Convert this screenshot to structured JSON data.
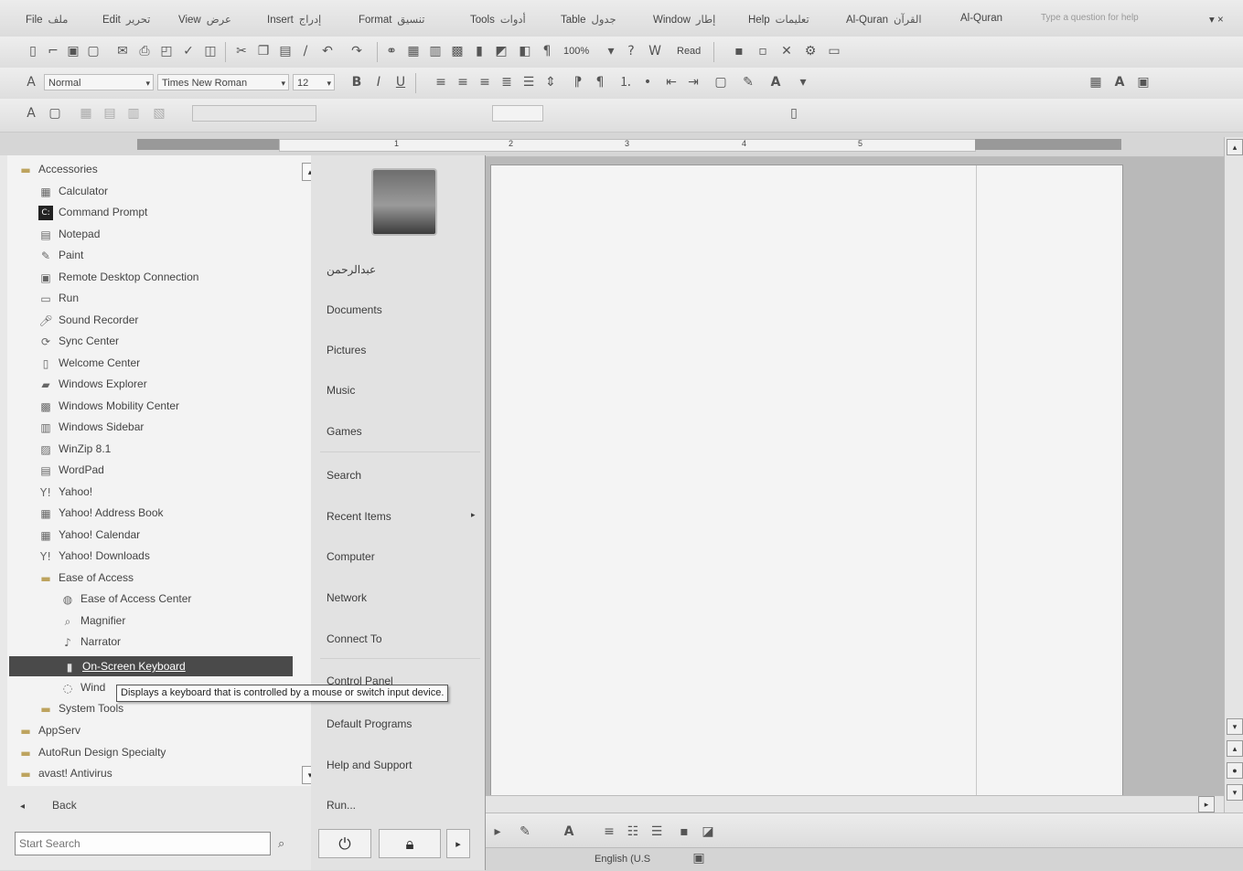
{
  "menu_bar": {
    "items": [
      {
        "label": "File",
        "arabic": "ملف"
      },
      {
        "label": "Edit",
        "arabic": "تحرير"
      },
      {
        "label": "View",
        "arabic": "عرض"
      },
      {
        "label": "Insert",
        "arabic": "إدراج"
      },
      {
        "label": "Format",
        "arabic": "تنسيق"
      },
      {
        "label": "Tools",
        "arabic": "أدوات"
      },
      {
        "label": "Table",
        "arabic": "جدول"
      },
      {
        "label": "Window",
        "arabic": "إطار"
      },
      {
        "label": "Help",
        "arabic": "تعليمات"
      },
      {
        "label": "Al-Quran",
        "arabic": "القرآن"
      },
      {
        "label": "Al-Quran",
        "arabic": ""
      }
    ],
    "help_box": "Type a question for help"
  },
  "standard_toolbar": {
    "zoom": "100%",
    "read_label": "Read"
  },
  "formatting_toolbar": {
    "style": "Normal",
    "font": "Times New Roman",
    "size": "12",
    "bold": "B",
    "italic": "I",
    "underline": "U"
  },
  "ruler": {
    "numbers": [
      "1",
      "2",
      "3",
      "4",
      "5"
    ]
  },
  "start_menu": {
    "programs": [
      {
        "label": "Accessories",
        "icon": "folder-icon",
        "level": 0
      },
      {
        "label": "Calculator",
        "icon": "calculator-icon",
        "level": 1
      },
      {
        "label": "Command Prompt",
        "icon": "command-prompt-icon",
        "level": 1
      },
      {
        "label": "Notepad",
        "icon": "notepad-icon",
        "level": 1
      },
      {
        "label": "Paint",
        "icon": "paint-icon",
        "level": 1
      },
      {
        "label": "Remote Desktop Connection",
        "icon": "remote-desktop-icon",
        "level": 1
      },
      {
        "label": "Run",
        "icon": "run-icon",
        "level": 1
      },
      {
        "label": "Sound Recorder",
        "icon": "microphone-icon",
        "level": 1
      },
      {
        "label": "Sync Center",
        "icon": "sync-icon",
        "level": 1
      },
      {
        "label": "Welcome Center",
        "icon": "welcome-icon",
        "level": 1
      },
      {
        "label": "Windows Explorer",
        "icon": "explorer-icon",
        "level": 1
      },
      {
        "label": "Windows Mobility Center",
        "icon": "mobility-icon",
        "level": 1
      },
      {
        "label": "Windows Sidebar",
        "icon": "sidebar-icon",
        "level": 1
      },
      {
        "label": "WinZip 8.1",
        "icon": "winzip-icon",
        "level": 1
      },
      {
        "label": "WordPad",
        "icon": "wordpad-icon",
        "level": 1
      },
      {
        "label": "Yahoo!",
        "icon": "yahoo-icon",
        "level": 1
      },
      {
        "label": "Yahoo! Address Book",
        "icon": "address-book-icon",
        "level": 1
      },
      {
        "label": "Yahoo! Calendar",
        "icon": "calendar-icon",
        "level": 1
      },
      {
        "label": "Yahoo! Downloads",
        "icon": "yahoo-icon",
        "level": 1
      },
      {
        "label": "Ease of Access",
        "icon": "folder-icon",
        "level": 1
      },
      {
        "label": "Ease of Access Center",
        "icon": "ease-of-access-icon",
        "level": 2
      },
      {
        "label": "Magnifier",
        "icon": "magnifier-icon",
        "level": 2
      },
      {
        "label": "Narrator",
        "icon": "narrator-icon",
        "level": 2
      },
      {
        "label": "On-Screen Keyboard",
        "icon": "keyboard-icon",
        "level": 2,
        "selected": true
      },
      {
        "label": "Wind",
        "icon": "speech-icon",
        "level": 2
      },
      {
        "label": "System Tools",
        "icon": "folder-icon",
        "level": 1
      },
      {
        "label": "AppServ",
        "icon": "folder-icon",
        "level": 0
      },
      {
        "label": "AutoRun Design Specialty",
        "icon": "folder-icon",
        "level": 0
      },
      {
        "label": "avast! Antivirus",
        "icon": "folder-icon",
        "level": 0
      }
    ],
    "tooltip": "Displays a keyboard that is controlled by a mouse or switch input device.",
    "back_label": "Back",
    "search_placeholder": "Start Search",
    "user_name": "عبدالرحمن",
    "right_items": [
      {
        "label": "Documents"
      },
      {
        "label": "Pictures"
      },
      {
        "label": "Music"
      },
      {
        "label": "Games"
      },
      {
        "label": "Search"
      },
      {
        "label": "Recent Items",
        "submenu": true
      },
      {
        "label": "Computer"
      },
      {
        "label": "Network"
      },
      {
        "label": "Connect To"
      },
      {
        "label": "Control Panel"
      },
      {
        "label": "Default Programs"
      },
      {
        "label": "Help and Support"
      },
      {
        "label": "Run..."
      }
    ]
  },
  "status_bar": {
    "language": "English (U.S"
  }
}
